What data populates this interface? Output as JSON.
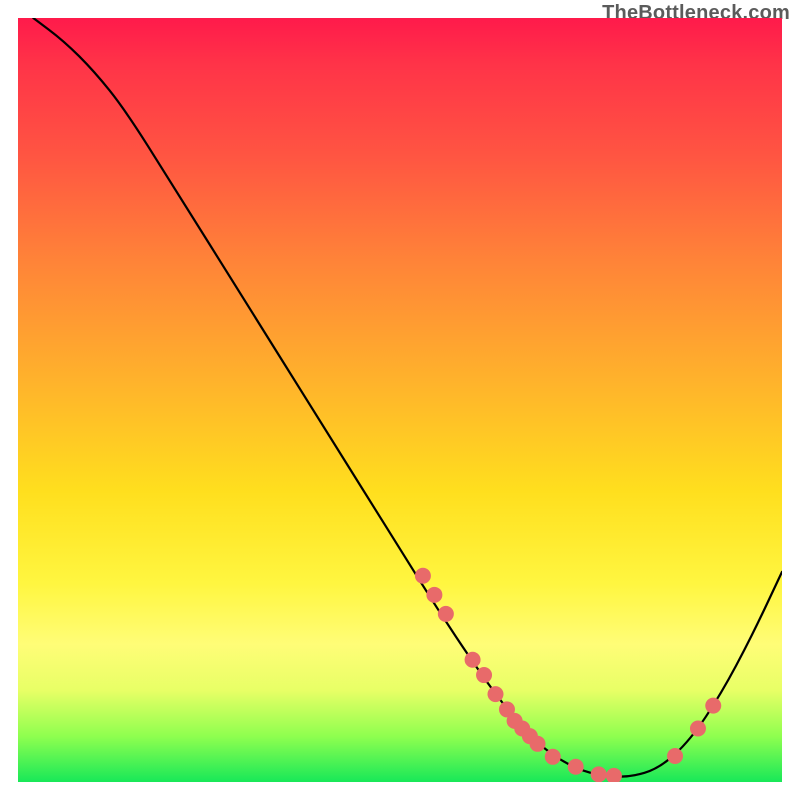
{
  "attribution": "TheBottleneck.com",
  "chart_data": {
    "type": "line",
    "title": "",
    "xlabel": "",
    "ylabel": "",
    "xlim": [
      0,
      100
    ],
    "ylim": [
      0,
      100
    ],
    "series": [
      {
        "name": "curve",
        "color": "#000000",
        "points": [
          {
            "x": 2.0,
            "y": 100.0
          },
          {
            "x": 6.0,
            "y": 97.0
          },
          {
            "x": 10.0,
            "y": 93.0
          },
          {
            "x": 14.0,
            "y": 88.0
          },
          {
            "x": 20.0,
            "y": 78.5
          },
          {
            "x": 30.0,
            "y": 62.5
          },
          {
            "x": 40.0,
            "y": 46.5
          },
          {
            "x": 50.0,
            "y": 30.5
          },
          {
            "x": 55.0,
            "y": 22.5
          },
          {
            "x": 60.0,
            "y": 15.0
          },
          {
            "x": 64.0,
            "y": 9.5
          },
          {
            "x": 68.0,
            "y": 5.0
          },
          {
            "x": 72.0,
            "y": 2.2
          },
          {
            "x": 76.0,
            "y": 0.8
          },
          {
            "x": 80.0,
            "y": 0.6
          },
          {
            "x": 84.0,
            "y": 1.8
          },
          {
            "x": 88.0,
            "y": 5.5
          },
          {
            "x": 92.0,
            "y": 11.5
          },
          {
            "x": 96.0,
            "y": 19.0
          },
          {
            "x": 100.0,
            "y": 27.5
          }
        ]
      }
    ],
    "markers": {
      "name": "highlighted-points",
      "color": "#e86a6a",
      "radius": 8,
      "points": [
        {
          "x": 53.0,
          "y": 27.0
        },
        {
          "x": 54.5,
          "y": 24.5
        },
        {
          "x": 56.0,
          "y": 22.0
        },
        {
          "x": 59.5,
          "y": 16.0
        },
        {
          "x": 61.0,
          "y": 14.0
        },
        {
          "x": 62.5,
          "y": 11.5
        },
        {
          "x": 64.0,
          "y": 9.5
        },
        {
          "x": 65.0,
          "y": 8.0
        },
        {
          "x": 66.0,
          "y": 7.0
        },
        {
          "x": 67.0,
          "y": 6.0
        },
        {
          "x": 68.0,
          "y": 5.0
        },
        {
          "x": 70.0,
          "y": 3.3
        },
        {
          "x": 73.0,
          "y": 2.0
        },
        {
          "x": 76.0,
          "y": 1.0
        },
        {
          "x": 78.0,
          "y": 0.8
        },
        {
          "x": 86.0,
          "y": 3.4
        },
        {
          "x": 89.0,
          "y": 7.0
        },
        {
          "x": 91.0,
          "y": 10.0
        }
      ]
    }
  }
}
